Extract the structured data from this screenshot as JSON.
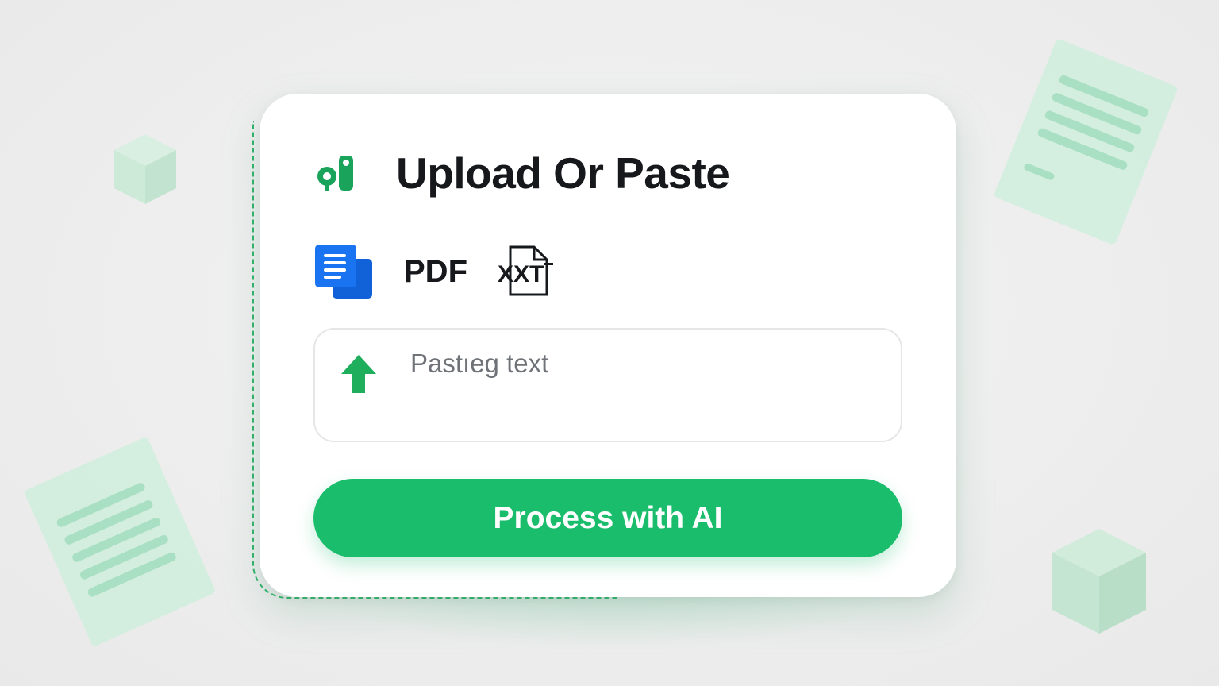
{
  "header": {
    "title": "Upload Or Paste",
    "logo_icon": "app-logo-icon"
  },
  "formats": {
    "docs_icon": "google-docs-icon",
    "pdf_label": "PDF",
    "txt_icon": "txt-file-icon",
    "txt_icon_text": "XXT"
  },
  "paste_box": {
    "icon": "upload-arrow-icon",
    "text": "Pastıeg text"
  },
  "process_button": {
    "label": "Process with AI"
  },
  "colors": {
    "accent": "#19bd6c",
    "docs_blue": "#1a6fe8",
    "title_text": "#16181c",
    "muted_text": "#6f7378",
    "deco_green": "#bfead2"
  }
}
